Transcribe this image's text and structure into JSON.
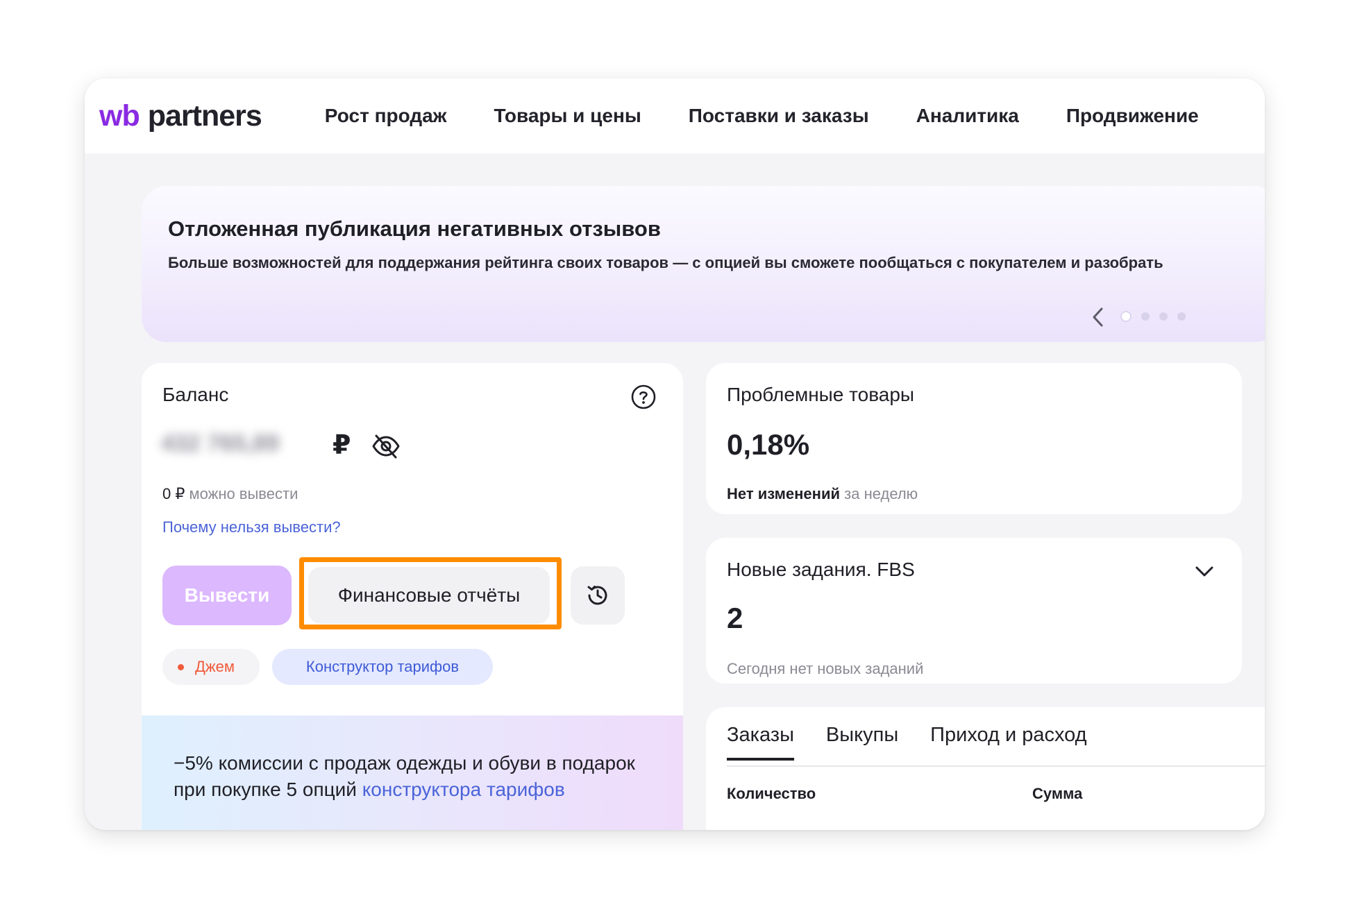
{
  "header": {
    "logo": {
      "wb": "wb",
      "partners": "partners"
    },
    "nav": [
      "Рост продаж",
      "Товары и цены",
      "Поставки и заказы",
      "Аналитика",
      "Продвижение"
    ]
  },
  "banner": {
    "title": "Отложенная публикация негативных отзывов",
    "text": "Больше возможностей для поддержания рейтинга своих товаров — с опцией вы сможете пообщаться с покупателем и разобрать",
    "dots_count": 4,
    "active_dot": 0
  },
  "balance": {
    "title": "Баланс",
    "amount_hidden": "432 765,89",
    "currency": "₽",
    "available_value": "0 ₽",
    "available_text": "можно вывести",
    "why_link": "Почему нельзя вывести?",
    "withdraw_button": "Вывести",
    "reports_button": "Финансовые отчёты",
    "chip_jam": "Джем",
    "chip_tariff": "Конструктор тарифов",
    "promo": {
      "text": "−5% комиссии с продаж одежды и обуви в подарок при покупке 5 опций ",
      "link": "конструктора тарифов"
    }
  },
  "problem_goods": {
    "title": "Проблемные товары",
    "value": "0,18%",
    "change": "Нет изменений",
    "period": "за неделю"
  },
  "fbs": {
    "title": "Новые задания. FBS",
    "value": "2",
    "subtitle": "Сегодня нет новых заданий"
  },
  "orders": {
    "tabs": [
      "Заказы",
      "Выкупы",
      "Приход и расход"
    ],
    "active_tab": 0,
    "columns": [
      "Количество",
      "Сумма"
    ]
  },
  "colors": {
    "brand": "#8a2be2",
    "highlight": "#ff8c00",
    "link": "#4a63d8",
    "withdraw_disabled": "#dcb8ff"
  }
}
